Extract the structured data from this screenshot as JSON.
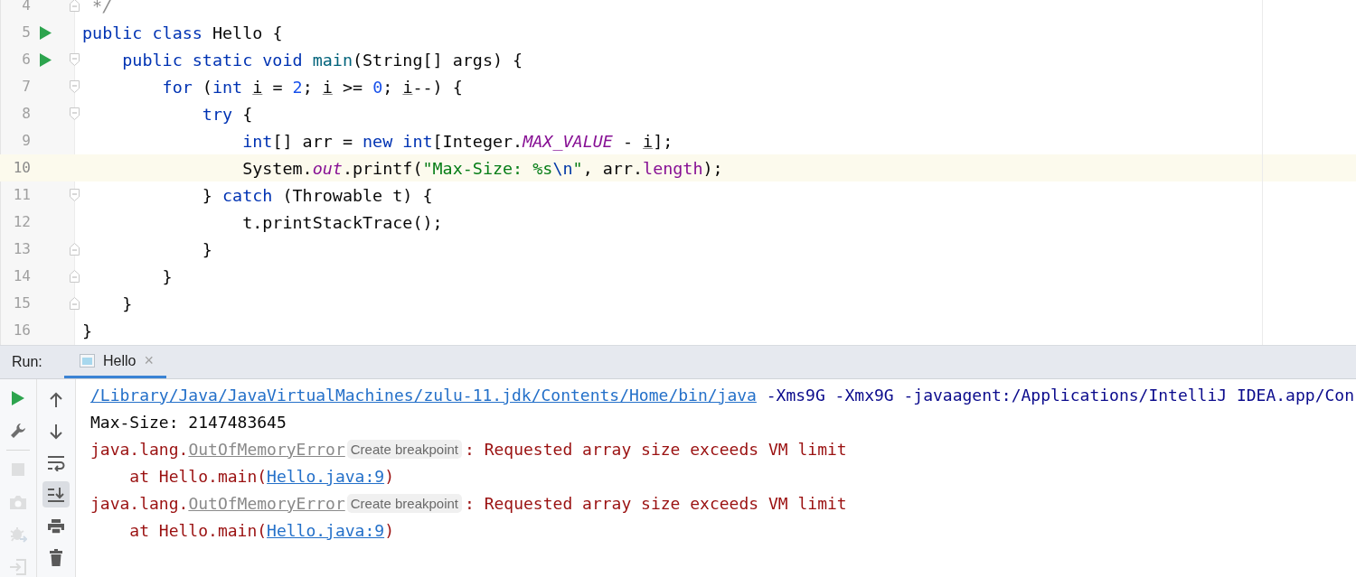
{
  "editor": {
    "lines": [
      {
        "number": "4",
        "current": false,
        "run": false,
        "fold_open": false,
        "fold_close": true,
        "tokens": [
          {
            "text": " */",
            "kind": "comment"
          }
        ]
      },
      {
        "number": "5",
        "current": false,
        "run": true,
        "fold_open": false,
        "fold_close": false,
        "tokens": [
          {
            "text": "public class",
            "kind": "kw"
          },
          {
            "text": " Hello {",
            "kind": "plain"
          }
        ]
      },
      {
        "number": "6",
        "current": false,
        "run": true,
        "fold_open": true,
        "fold_close": false,
        "tokens": [
          {
            "text": "    public static void",
            "kind": "kw"
          },
          {
            "text": " main",
            "kind": "method"
          },
          {
            "text": "(String[] args) {",
            "kind": "plain"
          }
        ]
      },
      {
        "number": "7",
        "current": false,
        "run": false,
        "fold_open": true,
        "fold_close": false,
        "tokens": [
          {
            "text": "        for",
            "kind": "kw"
          },
          {
            "text": " (",
            "kind": "plain"
          },
          {
            "text": "int ",
            "kind": "kw"
          },
          {
            "text": "i",
            "kind": "var"
          },
          {
            "text": " = ",
            "kind": "plain"
          },
          {
            "text": "2",
            "kind": "num"
          },
          {
            "text": "; ",
            "kind": "plain"
          },
          {
            "text": "i",
            "kind": "var"
          },
          {
            "text": " >= ",
            "kind": "plain"
          },
          {
            "text": "0",
            "kind": "num"
          },
          {
            "text": "; ",
            "kind": "plain"
          },
          {
            "text": "i",
            "kind": "var"
          },
          {
            "text": "--) {",
            "kind": "plain"
          }
        ]
      },
      {
        "number": "8",
        "current": false,
        "run": false,
        "fold_open": true,
        "fold_close": false,
        "tokens": [
          {
            "text": "            try",
            "kind": "kw"
          },
          {
            "text": " {",
            "kind": "plain"
          }
        ]
      },
      {
        "number": "9",
        "current": false,
        "run": false,
        "fold_open": false,
        "fold_close": false,
        "tokens": [
          {
            "text": "                int",
            "kind": "kw"
          },
          {
            "text": "[] arr = ",
            "kind": "plain"
          },
          {
            "text": "new int",
            "kind": "kw"
          },
          {
            "text": "[Integer.",
            "kind": "plain"
          },
          {
            "text": "MAX_VALUE",
            "kind": "field"
          },
          {
            "text": " - ",
            "kind": "plain"
          },
          {
            "text": "i",
            "kind": "var"
          },
          {
            "text": "];",
            "kind": "plain"
          }
        ]
      },
      {
        "number": "10",
        "current": true,
        "run": false,
        "fold_open": false,
        "fold_close": false,
        "tokens": [
          {
            "text": "                System.",
            "kind": "plain"
          },
          {
            "text": "out",
            "kind": "field"
          },
          {
            "text": ".printf(",
            "kind": "plain"
          },
          {
            "text": "\"Max-Size: %s",
            "kind": "str"
          },
          {
            "text": "\\n",
            "kind": "esc"
          },
          {
            "text": "\"",
            "kind": "str"
          },
          {
            "text": ", arr.",
            "kind": "plain"
          },
          {
            "text": "length",
            "kind": "member"
          },
          {
            "text": ");",
            "kind": "plain"
          }
        ]
      },
      {
        "number": "11",
        "current": false,
        "run": false,
        "fold_open": true,
        "fold_close": false,
        "tokens": [
          {
            "text": "            }",
            "kind": "plain"
          },
          {
            "text": " catch",
            "kind": "kw"
          },
          {
            "text": " (Throwable t) {",
            "kind": "plain"
          }
        ]
      },
      {
        "number": "12",
        "current": false,
        "run": false,
        "fold_open": false,
        "fold_close": false,
        "tokens": [
          {
            "text": "                t.printStackTrace();",
            "kind": "plain"
          }
        ]
      },
      {
        "number": "13",
        "current": false,
        "run": false,
        "fold_open": false,
        "fold_close": true,
        "tokens": [
          {
            "text": "            }",
            "kind": "plain"
          }
        ]
      },
      {
        "number": "14",
        "current": false,
        "run": false,
        "fold_open": false,
        "fold_close": true,
        "tokens": [
          {
            "text": "        }",
            "kind": "plain"
          }
        ]
      },
      {
        "number": "15",
        "current": false,
        "run": false,
        "fold_open": false,
        "fold_close": true,
        "tokens": [
          {
            "text": "    }",
            "kind": "plain"
          }
        ]
      },
      {
        "number": "16",
        "current": false,
        "run": false,
        "fold_open": false,
        "fold_close": false,
        "tokens": [
          {
            "text": "}",
            "kind": "plain"
          }
        ]
      }
    ]
  },
  "run_panel": {
    "label": "Run:",
    "tabs": [
      {
        "title": "Hello",
        "close": "×",
        "selected": true
      }
    ],
    "left_toolbar": [
      {
        "kind": "run",
        "disabled": false
      },
      {
        "kind": "wrench",
        "disabled": false
      },
      {
        "kind": "divider"
      },
      {
        "kind": "stop",
        "disabled": true
      },
      {
        "kind": "camera",
        "disabled": true
      },
      {
        "kind": "bug",
        "disabled": true
      },
      {
        "kind": "exit",
        "disabled": true
      }
    ],
    "right_toolbar": [
      {
        "kind": "up",
        "selected": false
      },
      {
        "kind": "down",
        "selected": false
      },
      {
        "kind": "wrap",
        "selected": false
      },
      {
        "kind": "scroll-end",
        "selected": true
      },
      {
        "kind": "print",
        "selected": false
      },
      {
        "kind": "trash",
        "selected": false
      }
    ],
    "console": [
      [
        {
          "text": "/Library/Java/JavaVirtualMachines/zulu-11.jdk/Contents/Home/bin/java",
          "kind": "link"
        },
        {
          "text": " -Xms9G -Xmx9G -javaagent:/Applications/IntelliJ IDEA.app/Con",
          "kind": "cmd"
        }
      ],
      [
        {
          "text": "Max-Size: 2147483645",
          "kind": "out"
        }
      ],
      [
        {
          "text": "java.lang.",
          "kind": "err"
        },
        {
          "text": "OutOfMemoryError",
          "kind": "errclass"
        },
        {
          "text": "Create breakpoint",
          "kind": "hint"
        },
        {
          "text": ": Requested array size exceeds VM limit",
          "kind": "err"
        }
      ],
      [
        {
          "text": "    at Hello.main(",
          "kind": "err"
        },
        {
          "text": "Hello.java:9",
          "kind": "link"
        },
        {
          "text": ")",
          "kind": "err"
        }
      ],
      [
        {
          "text": "java.lang.",
          "kind": "err"
        },
        {
          "text": "OutOfMemoryError",
          "kind": "errclass"
        },
        {
          "text": "Create breakpoint",
          "kind": "hint"
        },
        {
          "text": ": Requested array size exceeds VM limit",
          "kind": "err"
        }
      ],
      [
        {
          "text": "    at Hello.main(",
          "kind": "err"
        },
        {
          "text": "Hello.java:9",
          "kind": "link"
        },
        {
          "text": ")",
          "kind": "err"
        }
      ]
    ]
  }
}
